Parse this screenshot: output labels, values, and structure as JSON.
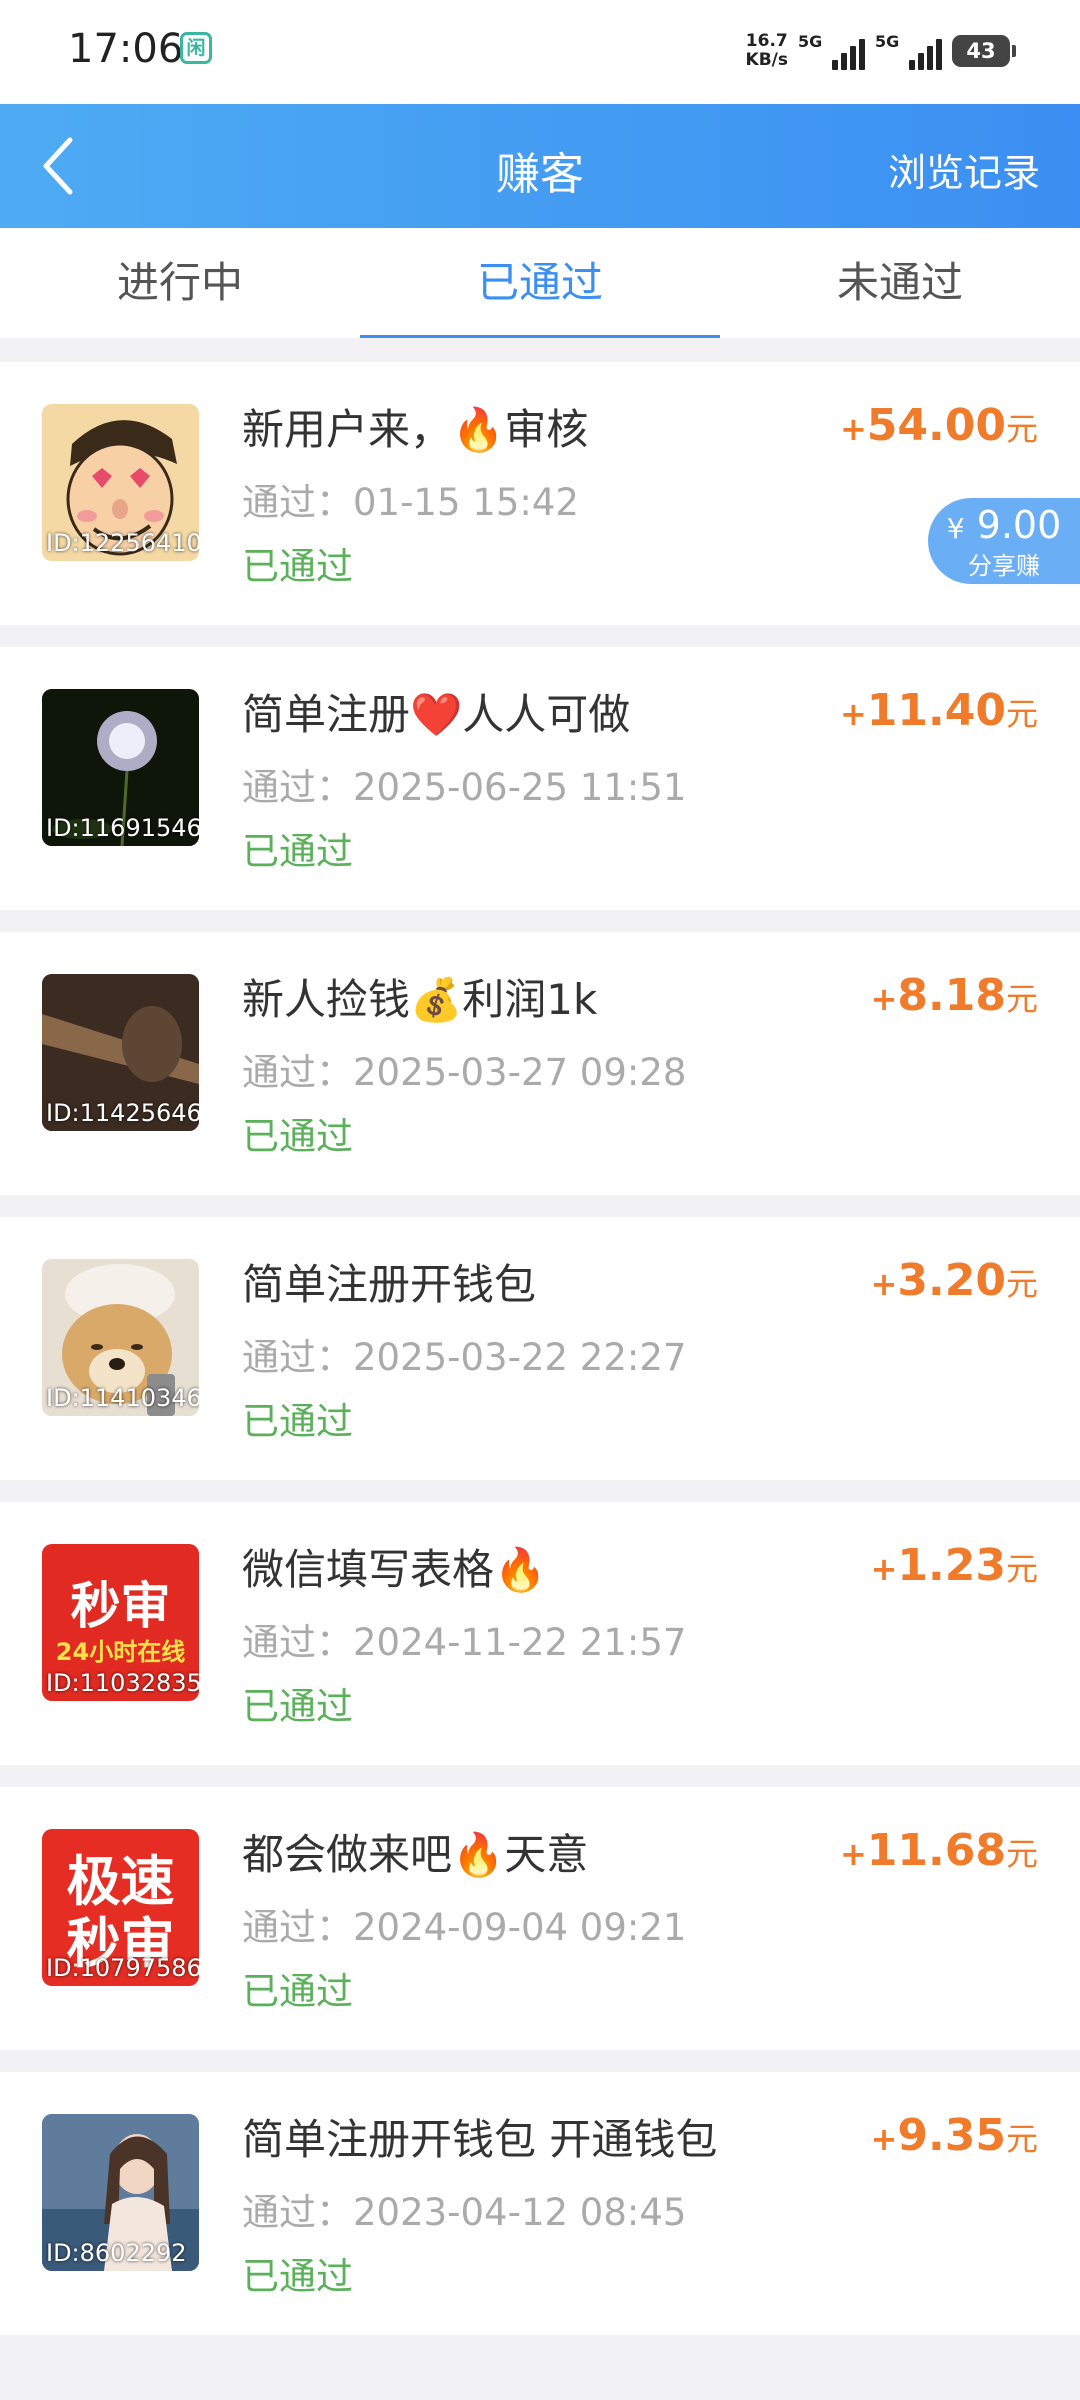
{
  "status_bar": {
    "time": "17:06",
    "app_badge": "闲",
    "net_speed_value": "16.7",
    "net_speed_unit": "KB/s",
    "sim1": "5G",
    "sim2": "5G",
    "battery": "43"
  },
  "header": {
    "title": "赚客",
    "right_label": "浏览记录"
  },
  "tabs": [
    {
      "label": "进行中",
      "active": false
    },
    {
      "label": "已通过",
      "active": true
    },
    {
      "label": "未通过",
      "active": false
    }
  ],
  "colors": {
    "header_start": "#4eabf3",
    "header_end": "#3b8ff2",
    "accent_blue": "#3b8ff2",
    "amount_orange": "#f07b2a",
    "status_green": "#5bb05a",
    "share_badge": "#6aaef5"
  },
  "items": [
    {
      "id_label": "ID:12256410",
      "title": "新用户来，🔥审核",
      "time": "通过：01-15 15:42",
      "status": "已通过",
      "plus": "+",
      "amount": "54.00",
      "unit": "元",
      "share_yen": "¥",
      "share_value": "9.00",
      "share_label": "分享赚"
    },
    {
      "id_label": "ID:11691546",
      "title": "简单注册❤️人人可做",
      "time": "通过：2025-06-25 11:51",
      "status": "已通过",
      "plus": "+",
      "amount": "11.40",
      "unit": "元"
    },
    {
      "id_label": "ID:11425646",
      "title": "新人捡钱💰利润1k",
      "time": "通过：2025-03-27 09:28",
      "status": "已通过",
      "plus": "+",
      "amount": "8.18",
      "unit": "元"
    },
    {
      "id_label": "ID:11410346",
      "title": "简单注册开钱包",
      "time": "通过：2025-03-22 22:27",
      "status": "已通过",
      "plus": "+",
      "amount": "3.20",
      "unit": "元"
    },
    {
      "id_label": "ID:11032835",
      "title": "微信填写表格🔥",
      "time": "通过：2024-11-22 21:57",
      "status": "已通过",
      "plus": "+",
      "amount": "1.23",
      "unit": "元",
      "thumb_text_1": "秒审",
      "thumb_text_2": "24小时在线"
    },
    {
      "id_label": "ID:10797586",
      "title": "都会做来吧🔥天意",
      "time": "通过：2024-09-04 09:21",
      "status": "已通过",
      "plus": "+",
      "amount": "11.68",
      "unit": "元",
      "thumb_text_1": "极速",
      "thumb_text_2": "秒审"
    },
    {
      "id_label": "ID:8602292",
      "title": "简单注册开钱包 开通钱包",
      "time": "通过：2023-04-12 08:45",
      "status": "已通过",
      "plus": "+",
      "amount": "9.35",
      "unit": "元"
    }
  ]
}
